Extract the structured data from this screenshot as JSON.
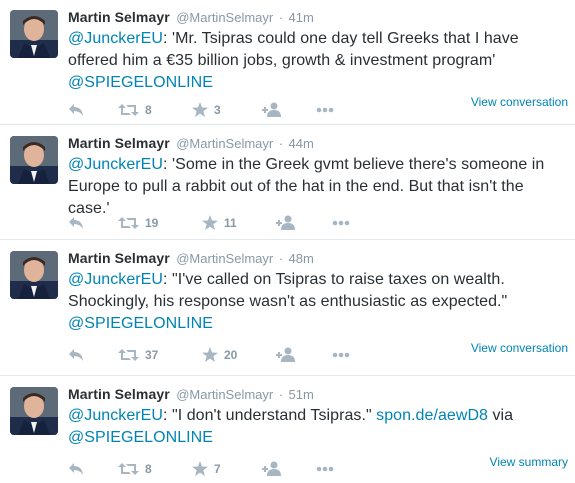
{
  "tweets": [
    {
      "name": "Martin Selmayr",
      "handle": "@MartinSelmayr",
      "time": "41m",
      "mention": "@JunckerEU",
      "text": ": 'Mr. Tsipras could one day tell Greeks that I have offered him a €35 billion jobs, growth & investment program'",
      "trailing_link": "@SPIEGELONLINE",
      "retweets": "8",
      "favorites": "3",
      "view_label": "View conversation"
    },
    {
      "name": "Martin Selmayr",
      "handle": "@MartinSelmayr",
      "time": "44m",
      "mention": "@JunckerEU",
      "text": ": 'Some in the Greek gvmt believe there's someone in Europe to pull a rabbit out of the hat in the end. But that isn't the case.'",
      "retweets": "19",
      "favorites": "11"
    },
    {
      "name": "Martin Selmayr",
      "handle": "@MartinSelmayr",
      "time": "48m",
      "mention": "@JunckerEU",
      "text": ": \"I've called on Tsipras to raise taxes on wealth. Shockingly, his response wasn't as enthusiastic as expected.\"",
      "trailing_link": "@SPIEGELONLINE",
      "retweets": "37",
      "favorites": "20",
      "view_label": "View conversation"
    },
    {
      "name": "Martin Selmayr",
      "handle": "@MartinSelmayr",
      "time": "51m",
      "mention": "@JunckerEU",
      "text": ": \"I don't understand Tsipras.\" ",
      "inline_link": "spon.de/aewD8",
      "text_after": " via",
      "trailing_link": "@SPIEGELONLINE",
      "retweets": "8",
      "favorites": "7",
      "view_label": "View summary"
    }
  ],
  "separator": "·",
  "icons": {
    "reply": "reply-arrow-icon",
    "retweet": "retweet-arrows-icon",
    "favorite": "star-icon",
    "follow": "add-user-icon",
    "more": "ellipsis-icon"
  },
  "colors": {
    "link": "#0084b4",
    "muted": "#8899a6",
    "text": "#292f33",
    "divider": "#e1e8ed"
  }
}
